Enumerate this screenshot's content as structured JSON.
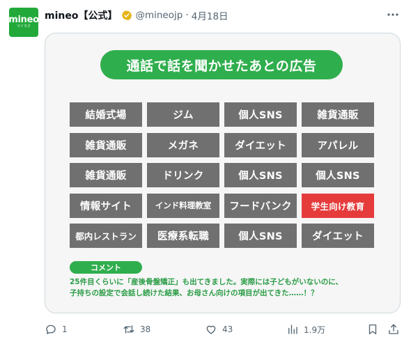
{
  "account": {
    "avatar_logo": "mineo",
    "avatar_sub": "マイネオ",
    "name": "mineo【公式】",
    "handle": "@mineojp",
    "separator": "·",
    "date": "4月18日",
    "verified_color": "#e5b416"
  },
  "card": {
    "title": "通話で話を聞かせたあとの広告",
    "cells": [
      "結婚式場",
      "ジム",
      "個人SNS",
      "雑貨通販",
      "雑貨通販",
      "メガネ",
      "ダイエット",
      "アパレル",
      "雑貨通販",
      "ドリンク",
      "個人SNS",
      "個人SNS",
      "情報サイト",
      "インド料理教室",
      "フードバンク",
      "学生向け教育",
      "都内レストラン",
      "医療系転職",
      "個人SNS",
      "ダイエット"
    ],
    "highlight_cell": "学生向け教育",
    "comment_label": "コメント",
    "comment_line1": "25件目くらいに「産後骨盤矯正」も出てきました。実際には子どもがいないのに、",
    "comment_line2": "子持ちの設定で会話し続けた結果、お母さん向けの項目が出てきた……！？"
  },
  "actions": {
    "reply_count": "1",
    "retweet_count": "38",
    "like_count": "43",
    "views_count": "1.9万"
  },
  "colors": {
    "brand_green": "#2fae4d",
    "cell_gray": "#707070",
    "highlight_red": "#e63b3b"
  }
}
